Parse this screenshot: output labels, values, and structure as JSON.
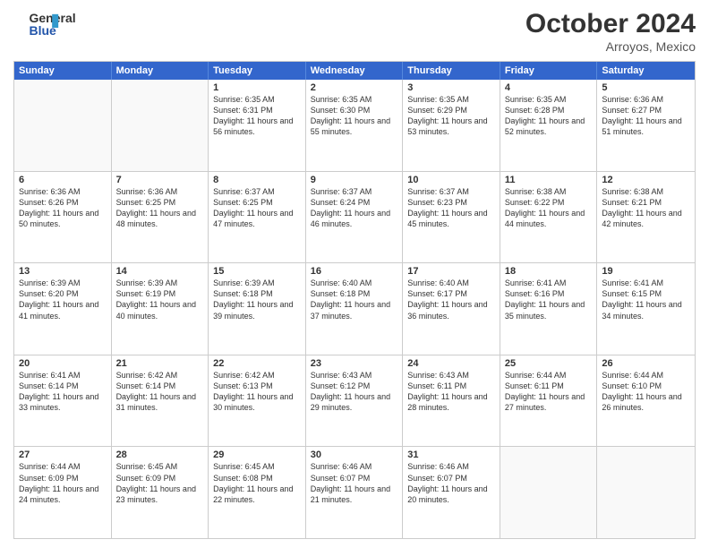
{
  "header": {
    "logo_line1": "General",
    "logo_line2": "Blue",
    "month": "October 2024",
    "location": "Arroyos, Mexico"
  },
  "days_of_week": [
    "Sunday",
    "Monday",
    "Tuesday",
    "Wednesday",
    "Thursday",
    "Friday",
    "Saturday"
  ],
  "rows": [
    [
      {
        "day": "",
        "sunrise": "",
        "sunset": "",
        "daylight": ""
      },
      {
        "day": "",
        "sunrise": "",
        "sunset": "",
        "daylight": ""
      },
      {
        "day": "1",
        "sunrise": "Sunrise: 6:35 AM",
        "sunset": "Sunset: 6:31 PM",
        "daylight": "Daylight: 11 hours and 56 minutes."
      },
      {
        "day": "2",
        "sunrise": "Sunrise: 6:35 AM",
        "sunset": "Sunset: 6:30 PM",
        "daylight": "Daylight: 11 hours and 55 minutes."
      },
      {
        "day": "3",
        "sunrise": "Sunrise: 6:35 AM",
        "sunset": "Sunset: 6:29 PM",
        "daylight": "Daylight: 11 hours and 53 minutes."
      },
      {
        "day": "4",
        "sunrise": "Sunrise: 6:35 AM",
        "sunset": "Sunset: 6:28 PM",
        "daylight": "Daylight: 11 hours and 52 minutes."
      },
      {
        "day": "5",
        "sunrise": "Sunrise: 6:36 AM",
        "sunset": "Sunset: 6:27 PM",
        "daylight": "Daylight: 11 hours and 51 minutes."
      }
    ],
    [
      {
        "day": "6",
        "sunrise": "Sunrise: 6:36 AM",
        "sunset": "Sunset: 6:26 PM",
        "daylight": "Daylight: 11 hours and 50 minutes."
      },
      {
        "day": "7",
        "sunrise": "Sunrise: 6:36 AM",
        "sunset": "Sunset: 6:25 PM",
        "daylight": "Daylight: 11 hours and 48 minutes."
      },
      {
        "day": "8",
        "sunrise": "Sunrise: 6:37 AM",
        "sunset": "Sunset: 6:25 PM",
        "daylight": "Daylight: 11 hours and 47 minutes."
      },
      {
        "day": "9",
        "sunrise": "Sunrise: 6:37 AM",
        "sunset": "Sunset: 6:24 PM",
        "daylight": "Daylight: 11 hours and 46 minutes."
      },
      {
        "day": "10",
        "sunrise": "Sunrise: 6:37 AM",
        "sunset": "Sunset: 6:23 PM",
        "daylight": "Daylight: 11 hours and 45 minutes."
      },
      {
        "day": "11",
        "sunrise": "Sunrise: 6:38 AM",
        "sunset": "Sunset: 6:22 PM",
        "daylight": "Daylight: 11 hours and 44 minutes."
      },
      {
        "day": "12",
        "sunrise": "Sunrise: 6:38 AM",
        "sunset": "Sunset: 6:21 PM",
        "daylight": "Daylight: 11 hours and 42 minutes."
      }
    ],
    [
      {
        "day": "13",
        "sunrise": "Sunrise: 6:39 AM",
        "sunset": "Sunset: 6:20 PM",
        "daylight": "Daylight: 11 hours and 41 minutes."
      },
      {
        "day": "14",
        "sunrise": "Sunrise: 6:39 AM",
        "sunset": "Sunset: 6:19 PM",
        "daylight": "Daylight: 11 hours and 40 minutes."
      },
      {
        "day": "15",
        "sunrise": "Sunrise: 6:39 AM",
        "sunset": "Sunset: 6:18 PM",
        "daylight": "Daylight: 11 hours and 39 minutes."
      },
      {
        "day": "16",
        "sunrise": "Sunrise: 6:40 AM",
        "sunset": "Sunset: 6:18 PM",
        "daylight": "Daylight: 11 hours and 37 minutes."
      },
      {
        "day": "17",
        "sunrise": "Sunrise: 6:40 AM",
        "sunset": "Sunset: 6:17 PM",
        "daylight": "Daylight: 11 hours and 36 minutes."
      },
      {
        "day": "18",
        "sunrise": "Sunrise: 6:41 AM",
        "sunset": "Sunset: 6:16 PM",
        "daylight": "Daylight: 11 hours and 35 minutes."
      },
      {
        "day": "19",
        "sunrise": "Sunrise: 6:41 AM",
        "sunset": "Sunset: 6:15 PM",
        "daylight": "Daylight: 11 hours and 34 minutes."
      }
    ],
    [
      {
        "day": "20",
        "sunrise": "Sunrise: 6:41 AM",
        "sunset": "Sunset: 6:14 PM",
        "daylight": "Daylight: 11 hours and 33 minutes."
      },
      {
        "day": "21",
        "sunrise": "Sunrise: 6:42 AM",
        "sunset": "Sunset: 6:14 PM",
        "daylight": "Daylight: 11 hours and 31 minutes."
      },
      {
        "day": "22",
        "sunrise": "Sunrise: 6:42 AM",
        "sunset": "Sunset: 6:13 PM",
        "daylight": "Daylight: 11 hours and 30 minutes."
      },
      {
        "day": "23",
        "sunrise": "Sunrise: 6:43 AM",
        "sunset": "Sunset: 6:12 PM",
        "daylight": "Daylight: 11 hours and 29 minutes."
      },
      {
        "day": "24",
        "sunrise": "Sunrise: 6:43 AM",
        "sunset": "Sunset: 6:11 PM",
        "daylight": "Daylight: 11 hours and 28 minutes."
      },
      {
        "day": "25",
        "sunrise": "Sunrise: 6:44 AM",
        "sunset": "Sunset: 6:11 PM",
        "daylight": "Daylight: 11 hours and 27 minutes."
      },
      {
        "day": "26",
        "sunrise": "Sunrise: 6:44 AM",
        "sunset": "Sunset: 6:10 PM",
        "daylight": "Daylight: 11 hours and 26 minutes."
      }
    ],
    [
      {
        "day": "27",
        "sunrise": "Sunrise: 6:44 AM",
        "sunset": "Sunset: 6:09 PM",
        "daylight": "Daylight: 11 hours and 24 minutes."
      },
      {
        "day": "28",
        "sunrise": "Sunrise: 6:45 AM",
        "sunset": "Sunset: 6:09 PM",
        "daylight": "Daylight: 11 hours and 23 minutes."
      },
      {
        "day": "29",
        "sunrise": "Sunrise: 6:45 AM",
        "sunset": "Sunset: 6:08 PM",
        "daylight": "Daylight: 11 hours and 22 minutes."
      },
      {
        "day": "30",
        "sunrise": "Sunrise: 6:46 AM",
        "sunset": "Sunset: 6:07 PM",
        "daylight": "Daylight: 11 hours and 21 minutes."
      },
      {
        "day": "31",
        "sunrise": "Sunrise: 6:46 AM",
        "sunset": "Sunset: 6:07 PM",
        "daylight": "Daylight: 11 hours and 20 minutes."
      },
      {
        "day": "",
        "sunrise": "",
        "sunset": "",
        "daylight": ""
      },
      {
        "day": "",
        "sunrise": "",
        "sunset": "",
        "daylight": ""
      }
    ]
  ]
}
